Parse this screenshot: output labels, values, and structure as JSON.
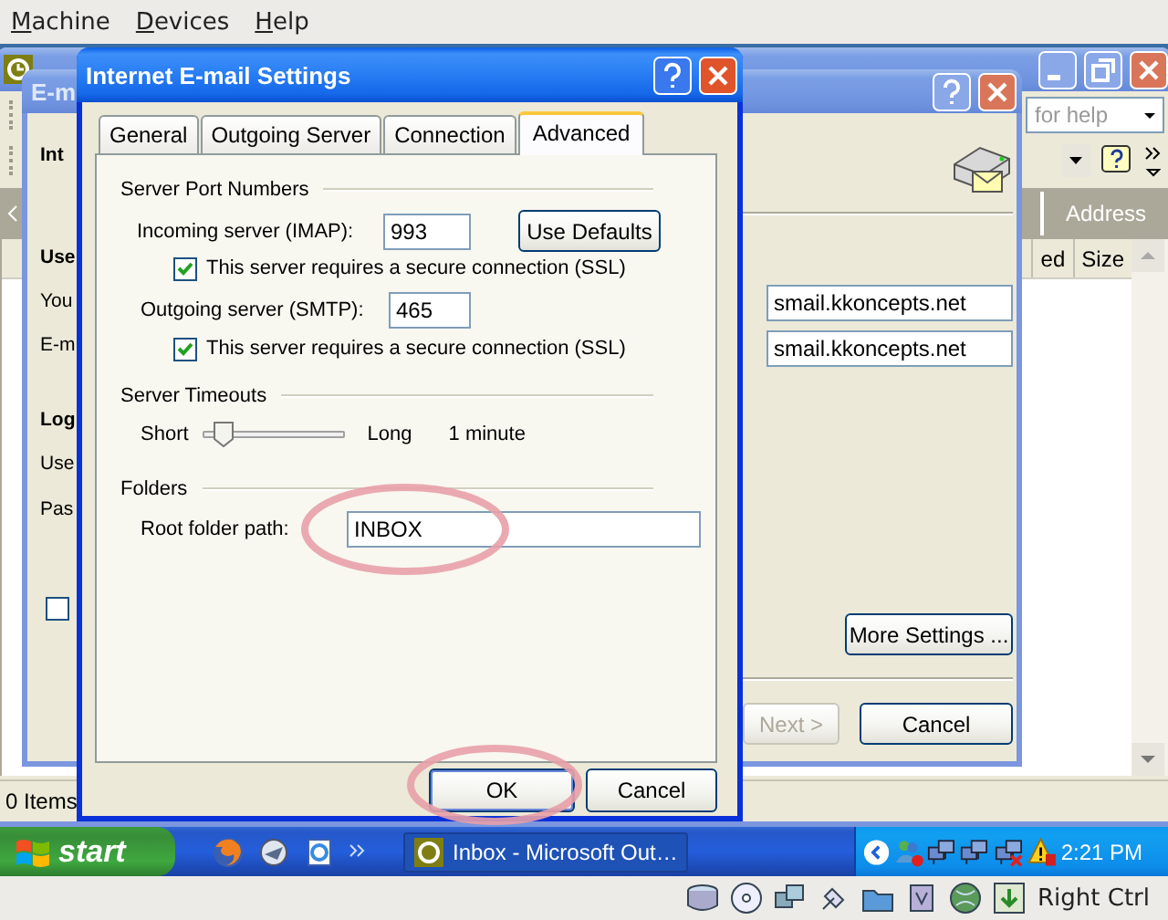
{
  "menu_bar": {
    "items": [
      "Machine",
      "Devices",
      "Help"
    ]
  },
  "outlook_window": {
    "help_field": {
      "placeholder": "for help"
    },
    "address_button": "Address",
    "columns": [
      "ed",
      "Size"
    ],
    "status_bar": "0 Items"
  },
  "accounts_dialog": {
    "title": "E-m",
    "left_labels": [
      {
        "text": "Int",
        "kind": "heading"
      },
      {
        "text": "Use",
        "kind": "heading"
      },
      {
        "text": "You",
        "kind": "label"
      },
      {
        "text": "E-m",
        "kind": "label"
      },
      {
        "text": "Log",
        "kind": "heading"
      },
      {
        "text": "Use",
        "kind": "label"
      },
      {
        "text": "Pas",
        "kind": "label"
      }
    ],
    "checkbox": {
      "checked": false
    },
    "server_fields": [
      "smail.kkoncepts.net",
      "smail.kkoncepts.net"
    ],
    "more_settings": "More Settings ...",
    "buttons": [
      {
        "label": "Next >",
        "disabled": true
      },
      {
        "label": "Cancel",
        "disabled": false
      }
    ]
  },
  "settings_dialog": {
    "title": "Internet E-mail Settings",
    "tabs": [
      {
        "label": "General",
        "selected": false
      },
      {
        "label": "Outgoing Server",
        "selected": false
      },
      {
        "label": "Connection",
        "selected": false
      },
      {
        "label": "Advanced",
        "selected": true
      }
    ],
    "port_group": {
      "title": "Server Port Numbers",
      "incoming_label": "Incoming server (IMAP):",
      "incoming_value": "993",
      "defaults_button": "Use Defaults",
      "incoming_ssl": {
        "label": "This server requires a secure connection (SSL)",
        "checked": true
      },
      "outgoing_label": "Outgoing server (SMTP):",
      "outgoing_value": "465",
      "outgoing_ssl": {
        "label": "This server requires a secure connection (SSL)",
        "checked": true
      }
    },
    "timeout_group": {
      "title": "Server Timeouts",
      "min_label": "Short",
      "max_label": "Long",
      "level": 0.08,
      "reading": "1 minute"
    },
    "folders_group": {
      "title": "Folders",
      "root_label": "Root folder path:",
      "root_value": "INBOX",
      "highlighted": true
    },
    "buttons": [
      {
        "label": "OK",
        "default": true,
        "highlighted": true
      },
      {
        "label": "Cancel",
        "default": false,
        "highlighted": false
      }
    ]
  },
  "taskbar": {
    "start": "start",
    "tasks": [
      {
        "label": "Inbox - Microsoft Out…"
      }
    ],
    "clock": "2:21 PM"
  },
  "host_status": {
    "key_label": "Right Ctrl"
  }
}
